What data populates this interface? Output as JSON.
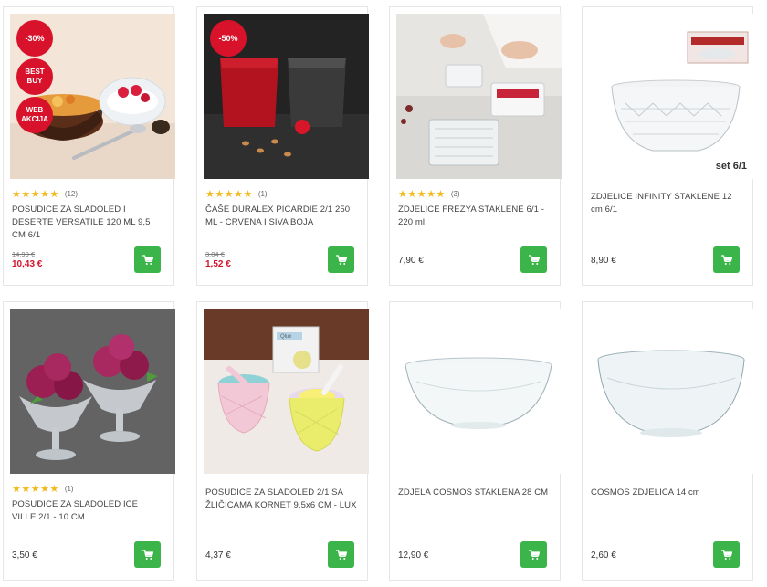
{
  "products": [
    {
      "title": "POSUDICE ZA SLADOLED I DESERTE VERSATILE 120 ML 9,5 CM 6/1",
      "rating_count": "(12)",
      "old_price": "14,90 €",
      "price": "10,43 €",
      "badges": [
        "-30%",
        "BEST BUY",
        "WEB AKCIJA"
      ]
    },
    {
      "title": "ČAŠE DURALEX PICARDIE 2/1 250 ML - CRVENA I SIVA BOJA",
      "rating_count": "(1)",
      "old_price": "3,04 €",
      "price": "1,52 €",
      "badges": [
        "-50%"
      ]
    },
    {
      "title": "ZDJELICE FREZYA STAKLENE 6/1 - 220 ml",
      "rating_count": "(3)",
      "price": "7,90 €"
    },
    {
      "title": "ZDJELICE INFINITY STAKLENE 12 cm 6/1",
      "price": "8,90 €",
      "image_label": "set 6/1"
    },
    {
      "title": "POSUDICE ZA SLADOLED ICE VILLE 2/1 - 10 CM",
      "rating_count": "(1)",
      "price": "3,50 €"
    },
    {
      "title": "POSUDICE ZA SLADOLED 2/1 SA ŽLIČICAMA KORNET 9,5x6 CM - LUX",
      "price": "4,37 €",
      "image_label": "Qlux"
    },
    {
      "title": "ZDJELA COSMOS STAKLENA 28 CM",
      "price": "12,90 €"
    },
    {
      "title": "COSMOS ZDJELICA 14 cm",
      "price": "2,60 €"
    }
  ],
  "stars": "★★★★★",
  "colors": {
    "accent_green": "#3bb54a",
    "sale_red": "#d8122b",
    "star": "#f2b91c"
  },
  "icons": {
    "cart": "cart-icon"
  }
}
